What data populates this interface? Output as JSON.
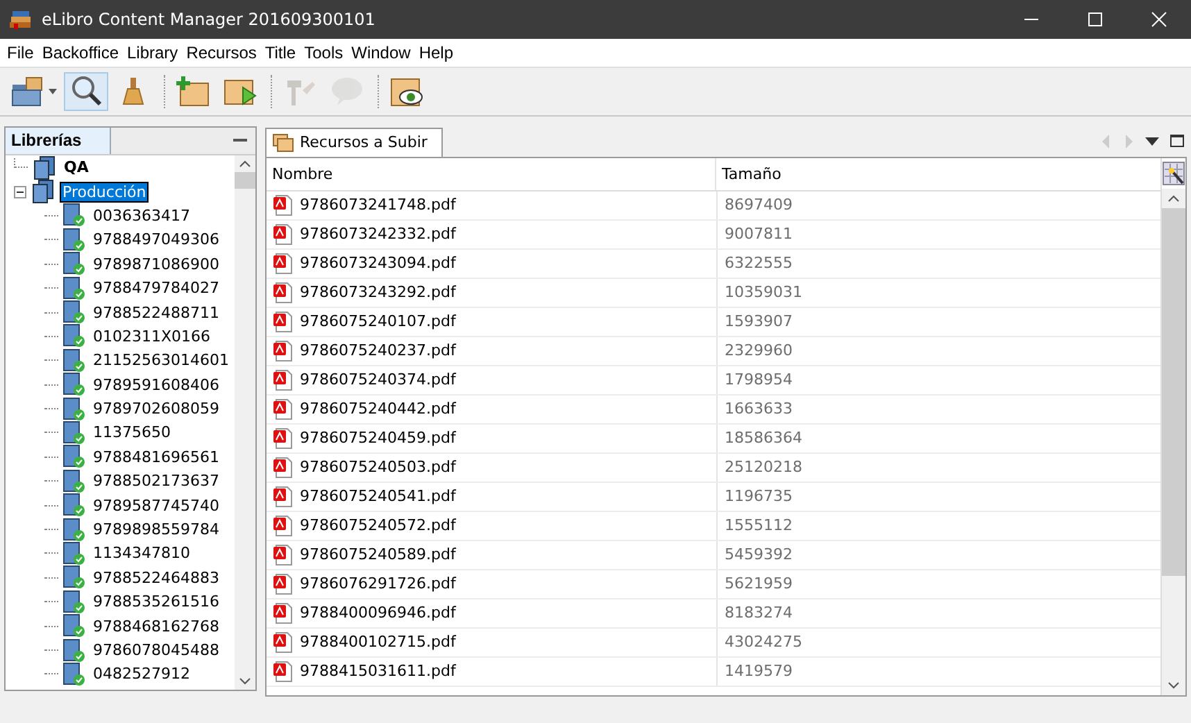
{
  "window": {
    "title": "eLibro Content Manager 201609300101"
  },
  "menu": [
    "File",
    "Backoffice",
    "Library",
    "Recursos",
    "Title",
    "Tools",
    "Window",
    "Help"
  ],
  "toolbar": [
    {
      "kind": "open",
      "pressed": false,
      "disabled": false,
      "dropdown": true
    },
    {
      "kind": "search",
      "pressed": true,
      "disabled": false
    },
    {
      "kind": "broom",
      "pressed": false,
      "disabled": false
    },
    {
      "kind": "sep"
    },
    {
      "kind": "newfolder",
      "pressed": false,
      "disabled": false
    },
    {
      "kind": "runfolder",
      "pressed": false,
      "disabled": false
    },
    {
      "kind": "sep"
    },
    {
      "kind": "tools",
      "pressed": false,
      "disabled": true
    },
    {
      "kind": "comment",
      "pressed": false,
      "disabled": true
    },
    {
      "kind": "sep"
    },
    {
      "kind": "viewfolder",
      "pressed": false,
      "disabled": false
    }
  ],
  "left_panel": {
    "title": "Librerías",
    "tree": [
      {
        "label": "QA",
        "selected": false
      },
      {
        "label": "Producción",
        "selected": true,
        "expanded": true,
        "children": [
          {
            "label": "0036363417"
          },
          {
            "label": "9788497049306"
          },
          {
            "label": "9789871086900"
          },
          {
            "label": "9788479784027"
          },
          {
            "label": "9788522488711"
          },
          {
            "label": "0102311X0166"
          },
          {
            "label": "21152563014601"
          },
          {
            "label": "9789591608406"
          },
          {
            "label": "9789702608059"
          },
          {
            "label": "11375650"
          },
          {
            "label": "9788481696561"
          },
          {
            "label": "9788502173637"
          },
          {
            "label": "9789587745740"
          },
          {
            "label": "9789898559784"
          },
          {
            "label": "1134347810"
          },
          {
            "label": "9788522464883"
          },
          {
            "label": "9788535261516"
          },
          {
            "label": "9788468162768"
          },
          {
            "label": "9786078045488"
          },
          {
            "label": "0482527912"
          }
        ]
      }
    ]
  },
  "tabs": [
    {
      "label": "Recursos a Subir",
      "selected": true
    }
  ],
  "table": {
    "columns": [
      "Nombre",
      "Tamaño"
    ],
    "rows": [
      [
        "9786073241748.pdf",
        "8697409"
      ],
      [
        "9786073242332.pdf",
        "9007811"
      ],
      [
        "9786073243094.pdf",
        "6322555"
      ],
      [
        "9786073243292.pdf",
        "10359031"
      ],
      [
        "9786075240107.pdf",
        "1593907"
      ],
      [
        "9786075240237.pdf",
        "2329960"
      ],
      [
        "9786075240374.pdf",
        "1798954"
      ],
      [
        "9786075240442.pdf",
        "1663633"
      ],
      [
        "9786075240459.pdf",
        "18586364"
      ],
      [
        "9786075240503.pdf",
        "25120218"
      ],
      [
        "9786075240541.pdf",
        "1196735"
      ],
      [
        "9786075240572.pdf",
        "1555112"
      ],
      [
        "9786075240589.pdf",
        "5459392"
      ],
      [
        "9786076291726.pdf",
        "5621959"
      ],
      [
        "9788400096946.pdf",
        "8183274"
      ],
      [
        "9788400102715.pdf",
        "43024275"
      ],
      [
        "9788415031611.pdf",
        "1419579"
      ]
    ]
  }
}
